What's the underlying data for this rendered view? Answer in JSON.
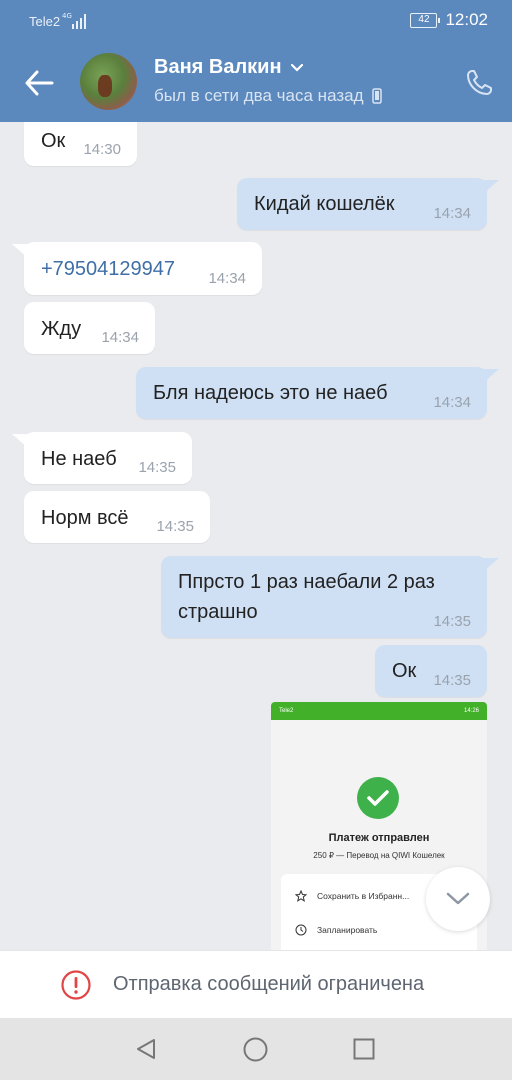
{
  "status_bar": {
    "carrier": "Tele2",
    "network": "4G",
    "battery": "42",
    "time": "12:02"
  },
  "header": {
    "name": "Ваня Валкин",
    "status": "был в сети два часа назад"
  },
  "messages": [
    {
      "dir": "in",
      "text": "Ок",
      "time": "14:30"
    },
    {
      "dir": "out",
      "text": "Кидай кошелёк",
      "time": "14:34"
    },
    {
      "dir": "in",
      "text": "+79504129947",
      "time": "14:34"
    },
    {
      "dir": "in",
      "text": "Жду",
      "time": "14:34"
    },
    {
      "dir": "out",
      "text": "Бля надеюсь это не наеб",
      "time": "14:34"
    },
    {
      "dir": "in",
      "text": "Не наеб",
      "time": "14:35"
    },
    {
      "dir": "in",
      "text": "Норм всё",
      "time": "14:35"
    },
    {
      "dir": "out",
      "text_line1": "Ппрсто 1 раз наебали 2 раз",
      "text_line2": "страшно",
      "time": "14:35"
    },
    {
      "dir": "out",
      "text": "Ок",
      "time": "14:35"
    }
  ],
  "attachment": {
    "status_left": "Tele2",
    "status_time": "14:26",
    "title": "Платеж отправлен",
    "subtitle": "250 ₽ — Перевод на QIWI Кошелек",
    "row1": "Сохранить в Избранн...",
    "row2": "Запланировать"
  },
  "restriction": {
    "text": "Отправка сообщений ограничена"
  },
  "colors": {
    "header": "#5b88bd",
    "outgoing": "#cfe0f5",
    "incoming": "#ffffff",
    "link": "#3f6fa6",
    "warning": "#e04646"
  }
}
